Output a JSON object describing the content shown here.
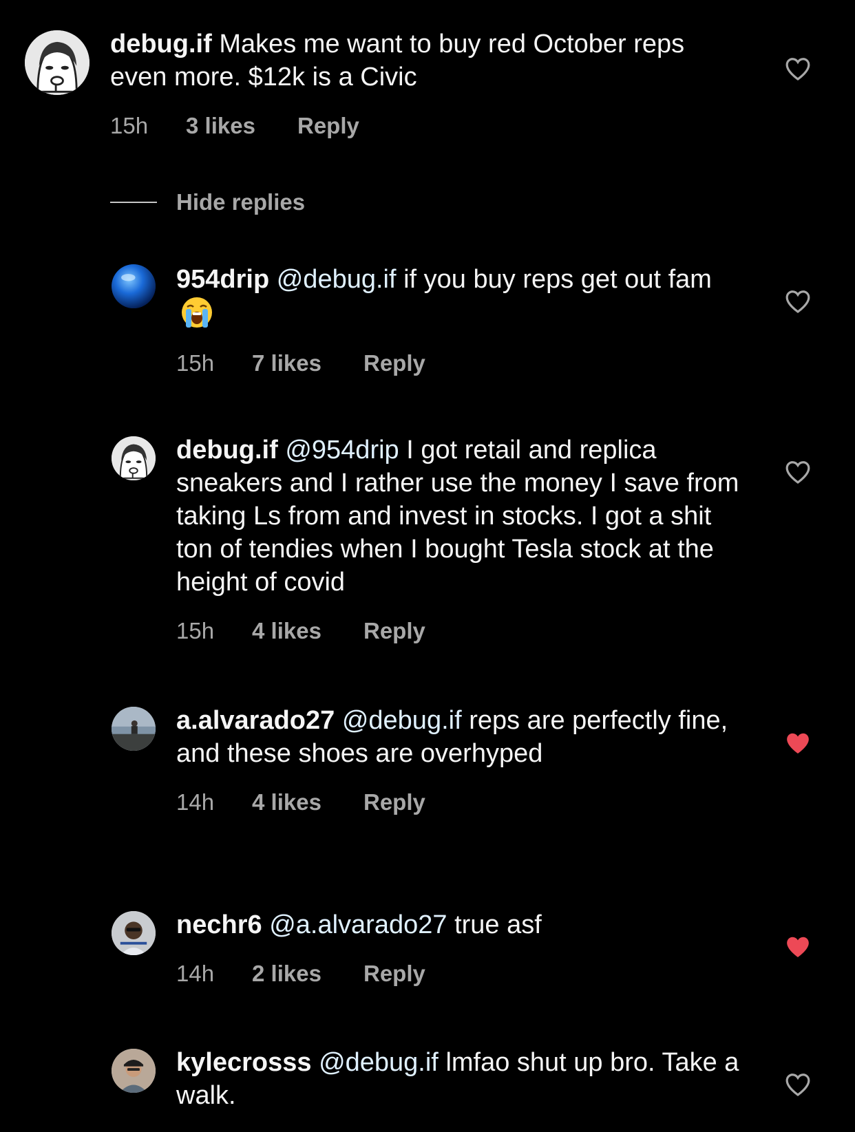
{
  "comment": {
    "username": "debug.if",
    "text": "Makes me want to buy red October reps even more. $12k is a Civic",
    "time": "15h",
    "likes": "3 likes",
    "reply_label": "Reply",
    "liked": false
  },
  "hide_replies_label": "Hide replies",
  "replies": [
    {
      "username": "954drip",
      "mention": "@debug.if",
      "text": "if you buy reps get out fam",
      "emoji": "loudly-crying-face-emoji",
      "time": "15h",
      "likes": "7 likes",
      "reply_label": "Reply",
      "liked": false
    },
    {
      "username": "debug.if",
      "mention": "@954drip",
      "text": "I got retail and replica sneakers and I rather use the money I save from taking Ls from and invest in stocks. I got a shit ton of tendies when I bought Tesla stock at the height of covid",
      "time": "15h",
      "likes": "4 likes",
      "reply_label": "Reply",
      "liked": false
    },
    {
      "username": "a.alvarado27",
      "mention": "@debug.if",
      "text": "reps are perfectly fine, and these shoes are overhyped",
      "time": "14h",
      "likes": "4 likes",
      "reply_label": "Reply",
      "liked": true
    },
    {
      "username": "nechr6",
      "mention": "@a.alvarado27",
      "text": "true asf",
      "time": "14h",
      "likes": "2 likes",
      "reply_label": "Reply",
      "liked": true
    },
    {
      "username": "kylecrosss",
      "mention": "@debug.if",
      "text": "lmfao shut up bro. Take a walk.",
      "liked": false
    }
  ],
  "colors": {
    "background": "#000000",
    "text": "#f5f5f5",
    "mention": "#e0f1ff",
    "meta": "#a8a8a8",
    "heart_liked": "#ed4956"
  }
}
